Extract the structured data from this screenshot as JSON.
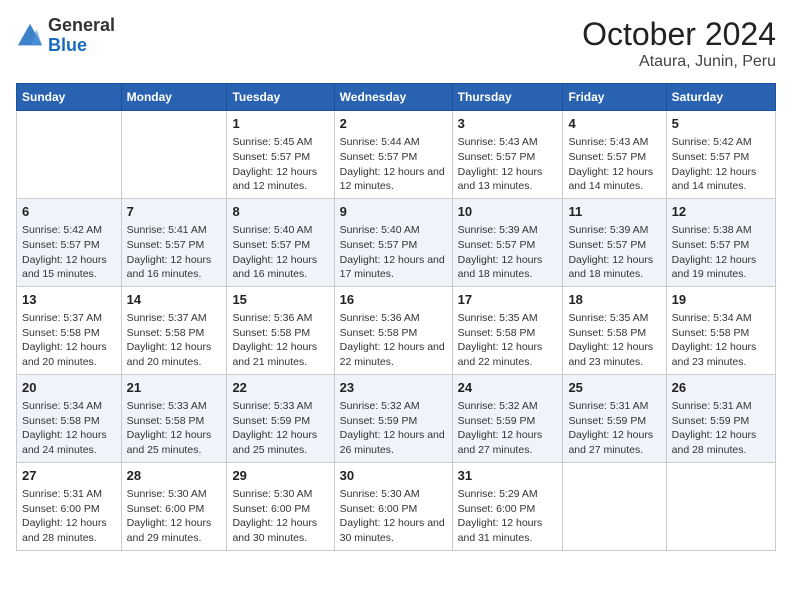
{
  "header": {
    "logo_general": "General",
    "logo_blue": "Blue",
    "main_title": "October 2024",
    "subtitle": "Ataura, Junin, Peru"
  },
  "days_of_week": [
    "Sunday",
    "Monday",
    "Tuesday",
    "Wednesday",
    "Thursday",
    "Friday",
    "Saturday"
  ],
  "weeks": [
    [
      {
        "num": "",
        "detail": ""
      },
      {
        "num": "",
        "detail": ""
      },
      {
        "num": "1",
        "detail": "Sunrise: 5:45 AM\nSunset: 5:57 PM\nDaylight: 12 hours and 12 minutes."
      },
      {
        "num": "2",
        "detail": "Sunrise: 5:44 AM\nSunset: 5:57 PM\nDaylight: 12 hours and 12 minutes."
      },
      {
        "num": "3",
        "detail": "Sunrise: 5:43 AM\nSunset: 5:57 PM\nDaylight: 12 hours and 13 minutes."
      },
      {
        "num": "4",
        "detail": "Sunrise: 5:43 AM\nSunset: 5:57 PM\nDaylight: 12 hours and 14 minutes."
      },
      {
        "num": "5",
        "detail": "Sunrise: 5:42 AM\nSunset: 5:57 PM\nDaylight: 12 hours and 14 minutes."
      }
    ],
    [
      {
        "num": "6",
        "detail": "Sunrise: 5:42 AM\nSunset: 5:57 PM\nDaylight: 12 hours and 15 minutes."
      },
      {
        "num": "7",
        "detail": "Sunrise: 5:41 AM\nSunset: 5:57 PM\nDaylight: 12 hours and 16 minutes."
      },
      {
        "num": "8",
        "detail": "Sunrise: 5:40 AM\nSunset: 5:57 PM\nDaylight: 12 hours and 16 minutes."
      },
      {
        "num": "9",
        "detail": "Sunrise: 5:40 AM\nSunset: 5:57 PM\nDaylight: 12 hours and 17 minutes."
      },
      {
        "num": "10",
        "detail": "Sunrise: 5:39 AM\nSunset: 5:57 PM\nDaylight: 12 hours and 18 minutes."
      },
      {
        "num": "11",
        "detail": "Sunrise: 5:39 AM\nSunset: 5:57 PM\nDaylight: 12 hours and 18 minutes."
      },
      {
        "num": "12",
        "detail": "Sunrise: 5:38 AM\nSunset: 5:57 PM\nDaylight: 12 hours and 19 minutes."
      }
    ],
    [
      {
        "num": "13",
        "detail": "Sunrise: 5:37 AM\nSunset: 5:58 PM\nDaylight: 12 hours and 20 minutes."
      },
      {
        "num": "14",
        "detail": "Sunrise: 5:37 AM\nSunset: 5:58 PM\nDaylight: 12 hours and 20 minutes."
      },
      {
        "num": "15",
        "detail": "Sunrise: 5:36 AM\nSunset: 5:58 PM\nDaylight: 12 hours and 21 minutes."
      },
      {
        "num": "16",
        "detail": "Sunrise: 5:36 AM\nSunset: 5:58 PM\nDaylight: 12 hours and 22 minutes."
      },
      {
        "num": "17",
        "detail": "Sunrise: 5:35 AM\nSunset: 5:58 PM\nDaylight: 12 hours and 22 minutes."
      },
      {
        "num": "18",
        "detail": "Sunrise: 5:35 AM\nSunset: 5:58 PM\nDaylight: 12 hours and 23 minutes."
      },
      {
        "num": "19",
        "detail": "Sunrise: 5:34 AM\nSunset: 5:58 PM\nDaylight: 12 hours and 23 minutes."
      }
    ],
    [
      {
        "num": "20",
        "detail": "Sunrise: 5:34 AM\nSunset: 5:58 PM\nDaylight: 12 hours and 24 minutes."
      },
      {
        "num": "21",
        "detail": "Sunrise: 5:33 AM\nSunset: 5:58 PM\nDaylight: 12 hours and 25 minutes."
      },
      {
        "num": "22",
        "detail": "Sunrise: 5:33 AM\nSunset: 5:59 PM\nDaylight: 12 hours and 25 minutes."
      },
      {
        "num": "23",
        "detail": "Sunrise: 5:32 AM\nSunset: 5:59 PM\nDaylight: 12 hours and 26 minutes."
      },
      {
        "num": "24",
        "detail": "Sunrise: 5:32 AM\nSunset: 5:59 PM\nDaylight: 12 hours and 27 minutes."
      },
      {
        "num": "25",
        "detail": "Sunrise: 5:31 AM\nSunset: 5:59 PM\nDaylight: 12 hours and 27 minutes."
      },
      {
        "num": "26",
        "detail": "Sunrise: 5:31 AM\nSunset: 5:59 PM\nDaylight: 12 hours and 28 minutes."
      }
    ],
    [
      {
        "num": "27",
        "detail": "Sunrise: 5:31 AM\nSunset: 6:00 PM\nDaylight: 12 hours and 28 minutes."
      },
      {
        "num": "28",
        "detail": "Sunrise: 5:30 AM\nSunset: 6:00 PM\nDaylight: 12 hours and 29 minutes."
      },
      {
        "num": "29",
        "detail": "Sunrise: 5:30 AM\nSunset: 6:00 PM\nDaylight: 12 hours and 30 minutes."
      },
      {
        "num": "30",
        "detail": "Sunrise: 5:30 AM\nSunset: 6:00 PM\nDaylight: 12 hours and 30 minutes."
      },
      {
        "num": "31",
        "detail": "Sunrise: 5:29 AM\nSunset: 6:00 PM\nDaylight: 12 hours and 31 minutes."
      },
      {
        "num": "",
        "detail": ""
      },
      {
        "num": "",
        "detail": ""
      }
    ]
  ]
}
